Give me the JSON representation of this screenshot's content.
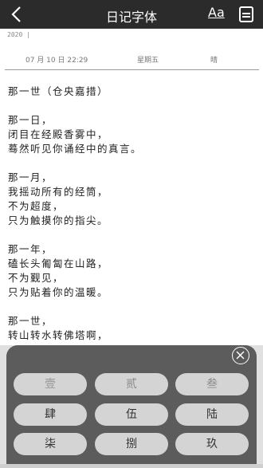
{
  "header": {
    "title": "日记字体",
    "font_button": "Aa"
  },
  "meta": {
    "year": "2020",
    "date": "07 月 10 日 22:29",
    "weekday": "星期五",
    "weather": "晴"
  },
  "content": {
    "paragraphs": [
      [
        "那一世（仓央嘉措）"
      ],
      [
        "那一日，",
        "闭目在经殿香雾中，",
        "蓦然听见你诵经中的真言。"
      ],
      [
        "那一月，",
        "我摇动所有的经筒，",
        "不为超度，",
        "只为触摸你的指尖。"
      ],
      [
        "那一年，",
        "磕长头匍匐在山路，",
        "不为觐见，",
        "只为贴着你的温暖。"
      ],
      [
        "那一世，",
        "转山转水转佛塔啊，"
      ]
    ]
  },
  "font_panel": {
    "options": [
      "壹",
      "贰",
      "叁",
      "肆",
      "伍",
      "陆",
      "柒",
      "捌",
      "玖"
    ]
  },
  "colors": {
    "topbar": "#2b2b2b",
    "panel": "#5c5c5c",
    "button": "#d4d4d4"
  },
  "icons": {
    "back": "chevron-left-icon",
    "save": "save-icon",
    "close": "close-icon"
  }
}
